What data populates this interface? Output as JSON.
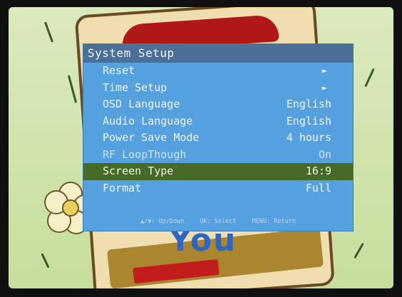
{
  "menu": {
    "title": "System Setup",
    "items": [
      {
        "label": "Reset",
        "value": "►",
        "type": "submenu"
      },
      {
        "label": "Time Setup",
        "value": "►",
        "type": "submenu"
      },
      {
        "label": "OSD Language",
        "value": "English",
        "type": "option"
      },
      {
        "label": "Audio Language",
        "value": "English",
        "type": "option"
      },
      {
        "label": "Power Save Mode",
        "value": "4 hours",
        "type": "option"
      },
      {
        "label": "RF LoopThough",
        "value": "On",
        "type": "option",
        "dim": true
      },
      {
        "label": "Screen Type",
        "value": "16:9",
        "type": "option",
        "selected": true
      },
      {
        "label": "Format",
        "value": "Full",
        "type": "option"
      }
    ],
    "footer": {
      "nav": "▲/▼: Up/Down",
      "ok": "OK: Select",
      "menu": "MENU: Return"
    }
  },
  "background": {
    "book_text": "You"
  },
  "colors": {
    "menu_bg": "#55a1df",
    "title_bar": "#4b6f96",
    "selected_row": "#476b26"
  }
}
